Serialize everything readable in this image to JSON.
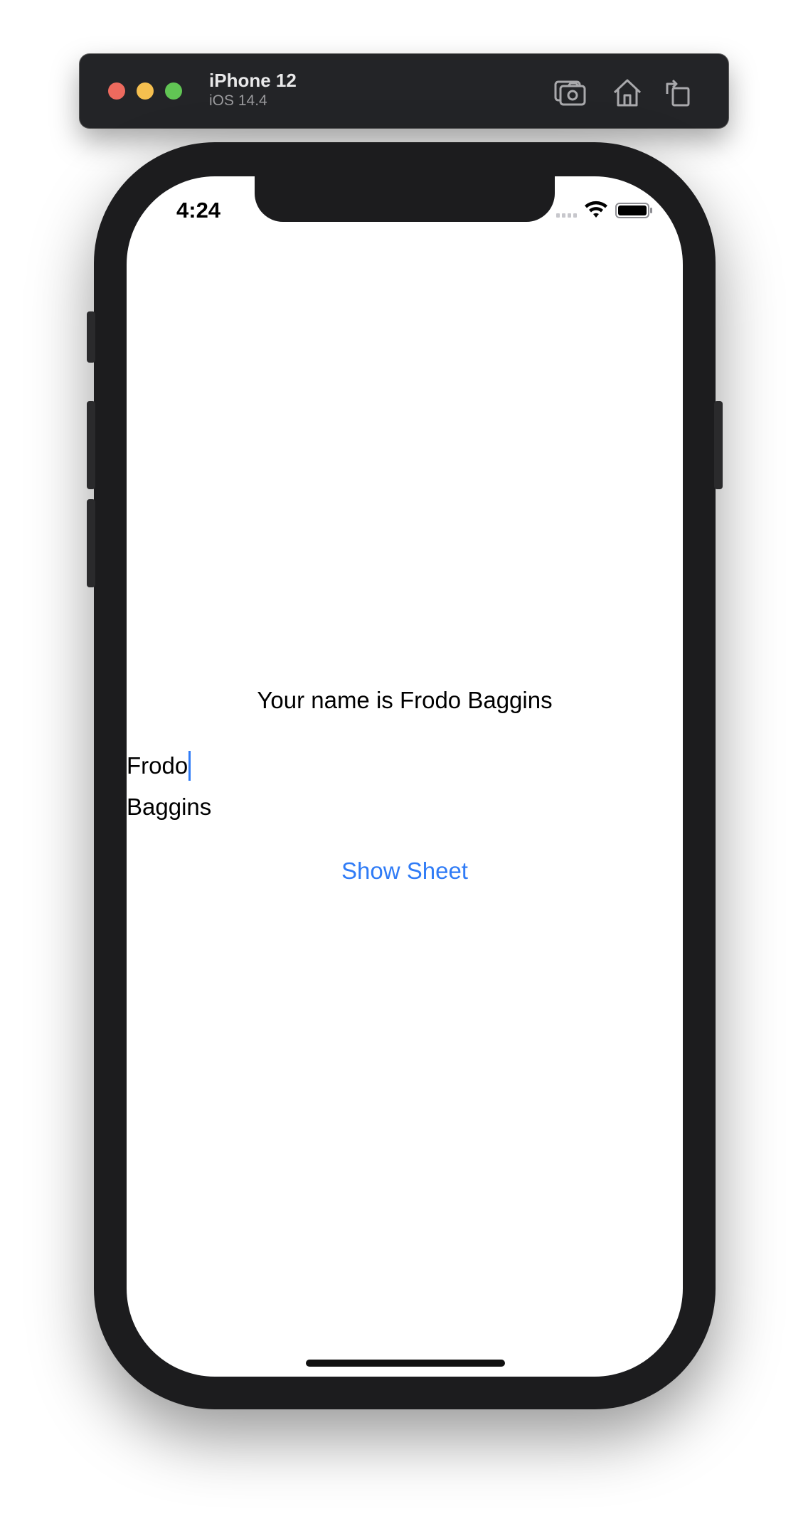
{
  "simulator": {
    "device_name": "iPhone 12",
    "os_version": "iOS 14.4",
    "toolbar_icons": [
      "screenshot-icon",
      "home-icon",
      "rotate-icon"
    ]
  },
  "status_bar": {
    "time": "4:24",
    "icons": [
      "cellular-signal-icon",
      "wifi-icon",
      "battery-icon"
    ]
  },
  "content": {
    "name_label": "Your name is Frodo Baggins",
    "first_name_value": "Frodo",
    "last_name_value": "Baggins",
    "show_sheet_label": "Show Sheet"
  },
  "colors": {
    "accent": "#2f7bf6",
    "phone_frame": "#1c1c1e",
    "titlebar": "#232427"
  }
}
